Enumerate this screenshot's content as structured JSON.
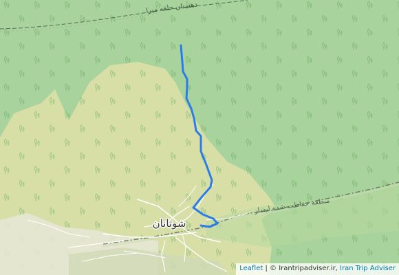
{
  "map": {
    "place_labels": {
      "village": "شوتانان",
      "top_road": "دهستان حلقه میرا",
      "protected_area": "منطقه حفاظت شده لیسار"
    },
    "colors": {
      "forest": "#a9d39c",
      "scrub": "#d9dfa6",
      "track": "#2b7ce9",
      "roads": "#ffffff",
      "boundary": "#6b7f6b",
      "tree_symbol": "#7fb875"
    }
  },
  "attribution": {
    "leaflet": "Leaflet",
    "separator": " | ",
    "copyright": "© Irantripadviser.ir, ",
    "site": "Iran Trip Adviser"
  }
}
